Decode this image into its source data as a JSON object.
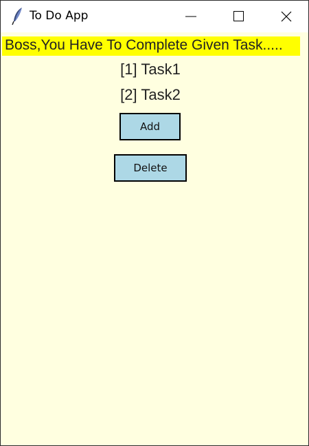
{
  "window": {
    "title": "To Do App",
    "icon": "feather-icon",
    "controls": [
      "minimize-icon",
      "maximize-icon",
      "close-icon"
    ]
  },
  "banner": {
    "text": "Boss,You Have To Complete Given Task.....",
    "background": "#ffff00"
  },
  "tasks": [
    {
      "label": "[1] Task1"
    },
    {
      "label": "[2] Task2"
    }
  ],
  "buttons": {
    "add_label": "Add",
    "delete_label": "Delete",
    "background": "#add8e6"
  },
  "colors": {
    "app_background": "#ffffe0"
  }
}
